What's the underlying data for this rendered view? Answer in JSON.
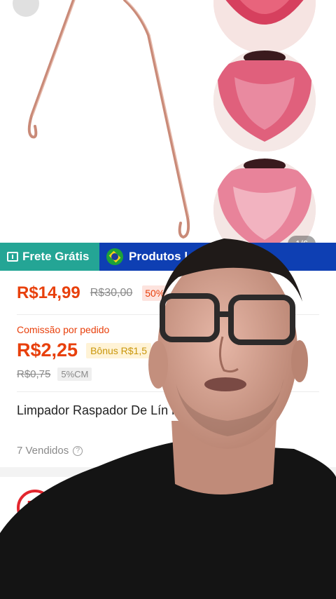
{
  "gallery": {
    "page_counter": "1/6"
  },
  "tags": {
    "frete": "Frete Grátis",
    "produtos": "Produtos l"
  },
  "product": {
    "price": "R$14,99",
    "old_price": "R$30,00",
    "discount": "50%",
    "commission_label": "Comissão por pedido",
    "commission_value": "R$2,25",
    "bonus": "Bônus R$1,5",
    "cm_old": "R$0,75",
    "cm_badge": "5%CM",
    "title": "Limpador Raspador De Lín                     ro Ayurveda",
    "sold": "7 Vendidos"
  },
  "shop": {
    "logo_letter": "D"
  },
  "colors": {
    "accent": "#e8400c",
    "frete_bg": "#24a595",
    "produtos_bg": "#0e3fb3"
  }
}
